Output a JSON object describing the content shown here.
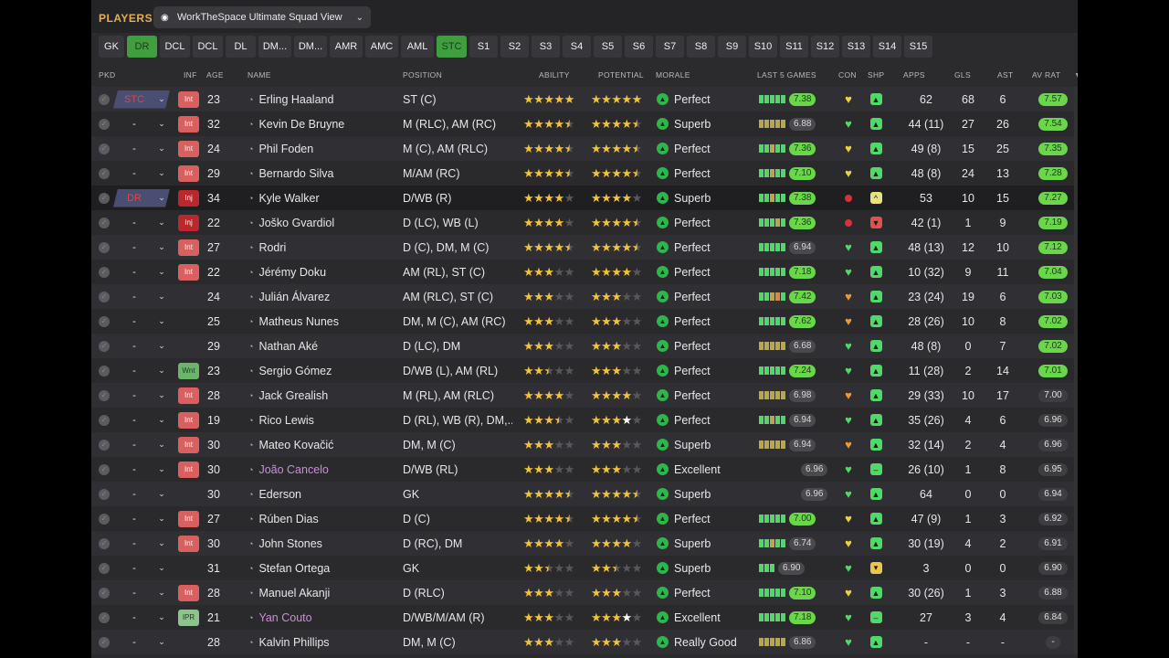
{
  "header": {
    "title": "PLAYERS",
    "view_name": "WorkTheSpace Ultimate Squad View"
  },
  "tabs": [
    {
      "label": "GK",
      "active": false,
      "w": 28
    },
    {
      "label": "DR",
      "active": true,
      "w": 33
    },
    {
      "label": "DCL",
      "active": false,
      "w": 33
    },
    {
      "label": "DCL",
      "active": false,
      "w": 33
    },
    {
      "label": "DL",
      "active": false,
      "w": 33
    },
    {
      "label": "DM...",
      "active": false,
      "w": 36
    },
    {
      "label": "DM...",
      "active": false,
      "w": 36
    },
    {
      "label": "AMR",
      "active": false,
      "w": 36
    },
    {
      "label": "AMC",
      "active": false,
      "w": 36
    },
    {
      "label": "AML",
      "active": false,
      "w": 36
    },
    {
      "label": "STC",
      "active": true,
      "w": 33
    },
    {
      "label": "S1",
      "active": false,
      "w": 31
    },
    {
      "label": "S2",
      "active": false,
      "w": 31
    },
    {
      "label": "S3",
      "active": false,
      "w": 31
    },
    {
      "label": "S4",
      "active": false,
      "w": 31
    },
    {
      "label": "S5",
      "active": false,
      "w": 31
    },
    {
      "label": "S6",
      "active": false,
      "w": 31
    },
    {
      "label": "S7",
      "active": false,
      "w": 31
    },
    {
      "label": "S8",
      "active": false,
      "w": 31
    },
    {
      "label": "S9",
      "active": false,
      "w": 31
    },
    {
      "label": "S10",
      "active": false,
      "w": 31
    },
    {
      "label": "S11",
      "active": false,
      "w": 31
    },
    {
      "label": "S12",
      "active": false,
      "w": 31
    },
    {
      "label": "S13",
      "active": false,
      "w": 31
    },
    {
      "label": "S14",
      "active": false,
      "w": 31
    },
    {
      "label": "S15",
      "active": false,
      "w": 31
    }
  ],
  "columns": {
    "pkd": "PKD",
    "inf": "INF",
    "age": "AGE",
    "name": "NAME",
    "position": "POSITION",
    "ability": "ABILITY",
    "potential": "POTENTIAL",
    "morale": "MORALE",
    "last5": "LAST 5 GAMES",
    "con": "CON",
    "shp": "SHP",
    "apps": "APPS",
    "gls": "GLS",
    "ast": "AST",
    "avrat": "AV RAT",
    "sort_icon": "▼"
  },
  "colors": {
    "accent": "#e3b04b",
    "tab_active": "#3f9f3f",
    "good_rating": "#6ad64a",
    "injury": "#b8282c",
    "intl": "#d9605e",
    "heart_green": "#4fd968",
    "heart_yellow": "#e8d34a",
    "heart_orange": "#e89a3a"
  },
  "players": [
    {
      "sel": "STC",
      "assigned": true,
      "inf": "Int",
      "age": "23",
      "name": "Erling Haaland",
      "loan": false,
      "position": "ST (C)",
      "ability": 5,
      "potential": 5,
      "pot_white": 0,
      "morale": "Perfect",
      "last5": [
        "g",
        "g",
        "g",
        "g",
        "g"
      ],
      "rating": "7.38",
      "rating_good": true,
      "con": "yellow",
      "shp": "green",
      "apps": "62",
      "gls": "68",
      "ast": "6",
      "avrat": "7.57",
      "av_good": true,
      "hl": false
    },
    {
      "sel": "-",
      "assigned": false,
      "inf": "Int",
      "age": "32",
      "name": "Kevin De Bruyne",
      "loan": false,
      "position": "M (RLC), AM (RC)",
      "ability": 4.5,
      "potential": 4.5,
      "pot_white": 0,
      "morale": "Superb",
      "last5": [
        "y",
        "y",
        "y",
        "y",
        "y"
      ],
      "rating": "6.88",
      "rating_good": false,
      "con": "green",
      "shp": "green",
      "apps": "44 (11)",
      "gls": "27",
      "ast": "26",
      "avrat": "7.54",
      "av_good": true,
      "hl": false
    },
    {
      "sel": "-",
      "assigned": false,
      "inf": "Int",
      "age": "24",
      "name": "Phil Foden",
      "loan": false,
      "position": "M (C), AM (RLC)",
      "ability": 4.5,
      "potential": 4.5,
      "pot_white": 0,
      "morale": "Perfect",
      "last5": [
        "g",
        "g",
        "y",
        "g",
        "g"
      ],
      "rating": "7.36",
      "rating_good": true,
      "con": "yellow",
      "shp": "green",
      "apps": "49 (8)",
      "gls": "15",
      "ast": "25",
      "avrat": "7.35",
      "av_good": true,
      "hl": false
    },
    {
      "sel": "-",
      "assigned": false,
      "inf": "Int",
      "age": "29",
      "name": "Bernardo Silva",
      "loan": false,
      "position": "M/AM (RC)",
      "ability": 4.5,
      "potential": 4.5,
      "pot_white": 0,
      "morale": "Perfect",
      "last5": [
        "g",
        "g",
        "y",
        "g",
        "g"
      ],
      "rating": "7.10",
      "rating_good": true,
      "con": "yellow",
      "shp": "green",
      "apps": "48 (8)",
      "gls": "24",
      "ast": "13",
      "avrat": "7.28",
      "av_good": true,
      "hl": false
    },
    {
      "sel": "DR",
      "assigned": true,
      "inf": "Inj",
      "age": "34",
      "name": "Kyle Walker",
      "loan": false,
      "position": "D/WB (R)",
      "ability": 4,
      "potential": 4,
      "pot_white": 0,
      "morale": "Superb",
      "last5": [
        "g",
        "g",
        "y",
        "g",
        "g"
      ],
      "rating": "7.38",
      "rating_good": true,
      "con": "dot",
      "shp": "up",
      "apps": "53",
      "gls": "10",
      "ast": "15",
      "avrat": "7.27",
      "av_good": true,
      "hl": true
    },
    {
      "sel": "-",
      "assigned": false,
      "inf": "Inj",
      "age": "22",
      "name": "Joško Gvardiol",
      "loan": false,
      "position": "D (LC), WB (L)",
      "ability": 4,
      "potential": 4.5,
      "pot_white": 0,
      "morale": "Perfect",
      "last5": [
        "g",
        "g",
        "g",
        "y",
        "g"
      ],
      "rating": "7.36",
      "rating_good": true,
      "con": "dot",
      "shp": "red",
      "apps": "42 (1)",
      "gls": "1",
      "ast": "9",
      "avrat": "7.19",
      "av_good": true,
      "hl": false
    },
    {
      "sel": "-",
      "assigned": false,
      "inf": "Int",
      "age": "27",
      "name": "Rodri",
      "loan": false,
      "position": "D (C), DM, M (C)",
      "ability": 4.5,
      "potential": 4.5,
      "pot_white": 0,
      "morale": "Perfect",
      "last5": [
        "g",
        "g",
        "g",
        "g",
        "g"
      ],
      "rating": "6.94",
      "rating_good": false,
      "con": "green",
      "shp": "green",
      "apps": "48 (13)",
      "gls": "12",
      "ast": "10",
      "avrat": "7.12",
      "av_good": true,
      "hl": false
    },
    {
      "sel": "-",
      "assigned": false,
      "inf": "Int",
      "age": "22",
      "name": "Jérémy Doku",
      "loan": false,
      "position": "AM (RL), ST (C)",
      "ability": 3,
      "potential": 4,
      "pot_white": 0,
      "morale": "Perfect",
      "last5": [
        "g",
        "g",
        "g",
        "g",
        "g"
      ],
      "rating": "7.18",
      "rating_good": true,
      "con": "green",
      "shp": "green",
      "apps": "10 (32)",
      "gls": "9",
      "ast": "11",
      "avrat": "7.04",
      "av_good": true,
      "hl": false
    },
    {
      "sel": "-",
      "assigned": false,
      "inf": "",
      "age": "24",
      "name": "Julián Álvarez",
      "loan": false,
      "position": "AM (RLC), ST (C)",
      "ability": 3,
      "potential": 3,
      "pot_white": 0,
      "morale": "Perfect",
      "last5": [
        "g",
        "g",
        "y",
        "o",
        "g"
      ],
      "rating": "7.42",
      "rating_good": true,
      "con": "orange",
      "shp": "green",
      "apps": "23 (24)",
      "gls": "19",
      "ast": "6",
      "avrat": "7.03",
      "av_good": true,
      "hl": false
    },
    {
      "sel": "-",
      "assigned": false,
      "inf": "",
      "age": "25",
      "name": "Matheus Nunes",
      "loan": false,
      "position": "DM, M (C), AM (RC)",
      "ability": 3,
      "potential": 3,
      "pot_white": 0,
      "morale": "Perfect",
      "last5": [
        "g",
        "g",
        "g",
        "g",
        "g"
      ],
      "rating": "7.62",
      "rating_good": true,
      "con": "orange",
      "shp": "green",
      "apps": "28 (26)",
      "gls": "10",
      "ast": "8",
      "avrat": "7.02",
      "av_good": true,
      "hl": false
    },
    {
      "sel": "-",
      "assigned": false,
      "inf": "",
      "age": "29",
      "name": "Nathan Aké",
      "loan": false,
      "position": "D (LC), DM",
      "ability": 3,
      "potential": 3,
      "pot_white": 0,
      "morale": "Perfect",
      "last5": [
        "y",
        "y",
        "y",
        "y",
        "y"
      ],
      "rating": "6.68",
      "rating_good": false,
      "con": "green",
      "shp": "green",
      "apps": "48 (8)",
      "gls": "0",
      "ast": "7",
      "avrat": "7.02",
      "av_good": true,
      "hl": false
    },
    {
      "sel": "-",
      "assigned": false,
      "inf": "Wnt",
      "age": "23",
      "name": "Sergio Gómez",
      "loan": false,
      "position": "D/WB (L), AM (RL)",
      "ability": 2.5,
      "potential": 3,
      "pot_white": 0,
      "morale": "Perfect",
      "last5": [
        "g",
        "g",
        "g",
        "g",
        "g"
      ],
      "rating": "7.24",
      "rating_good": true,
      "con": "green",
      "shp": "green",
      "apps": "11 (28)",
      "gls": "2",
      "ast": "14",
      "avrat": "7.01",
      "av_good": true,
      "hl": false
    },
    {
      "sel": "-",
      "assigned": false,
      "inf": "Int",
      "age": "28",
      "name": "Jack Grealish",
      "loan": false,
      "position": "M (RL), AM (RLC)",
      "ability": 4,
      "potential": 4,
      "pot_white": 0,
      "morale": "Perfect",
      "last5": [
        "y",
        "y",
        "y",
        "y",
        "y"
      ],
      "rating": "6.98",
      "rating_good": false,
      "con": "orange",
      "shp": "green",
      "apps": "29 (33)",
      "gls": "10",
      "ast": "17",
      "avrat": "7.00",
      "av_good": false,
      "hl": false
    },
    {
      "sel": "-",
      "assigned": false,
      "inf": "Int",
      "age": "19",
      "name": "Rico Lewis",
      "loan": false,
      "position": "D (RL), WB (R), DM,...",
      "ability": 3.5,
      "potential": 3,
      "pot_white": 1.5,
      "morale": "Perfect",
      "last5": [
        "g",
        "g",
        "y",
        "g",
        "g"
      ],
      "rating": "6.94",
      "rating_good": false,
      "con": "green",
      "shp": "green",
      "apps": "35 (26)",
      "gls": "4",
      "ast": "6",
      "avrat": "6.96",
      "av_good": false,
      "hl": false
    },
    {
      "sel": "-",
      "assigned": false,
      "inf": "Int",
      "age": "30",
      "name": "Mateo Kovačić",
      "loan": false,
      "position": "DM, M (C)",
      "ability": 3,
      "potential": 3,
      "pot_white": 0,
      "morale": "Superb",
      "last5": [
        "y",
        "y",
        "y",
        "y",
        "y"
      ],
      "rating": "6.94",
      "rating_good": false,
      "con": "orange",
      "shp": "green",
      "apps": "32 (14)",
      "gls": "2",
      "ast": "4",
      "avrat": "6.96",
      "av_good": false,
      "hl": false
    },
    {
      "sel": "-",
      "assigned": false,
      "inf": "Int",
      "age": "30",
      "name": "João Cancelo",
      "loan": true,
      "position": "D/WB (RL)",
      "ability": 3,
      "potential": 3,
      "pot_white": 0,
      "morale": "Excellent",
      "last5": [],
      "rating": "6.96",
      "rating_good": false,
      "con": "green",
      "shp": "flat",
      "apps": "26 (10)",
      "gls": "1",
      "ast": "8",
      "avrat": "6.95",
      "av_good": false,
      "hl": false
    },
    {
      "sel": "-",
      "assigned": false,
      "inf": "",
      "age": "30",
      "name": "Ederson",
      "loan": false,
      "position": "GK",
      "ability": 4.5,
      "potential": 4.5,
      "pot_white": 0,
      "morale": "Superb",
      "last5": [],
      "rating": "6.96",
      "rating_good": false,
      "con": "green",
      "shp": "green",
      "apps": "64",
      "gls": "0",
      "ast": "0",
      "avrat": "6.94",
      "av_good": false,
      "hl": false
    },
    {
      "sel": "-",
      "assigned": false,
      "inf": "Int",
      "age": "27",
      "name": "Rúben Dias",
      "loan": false,
      "position": "D (C)",
      "ability": 4.5,
      "potential": 4.5,
      "pot_white": 0,
      "morale": "Perfect",
      "last5": [
        "g",
        "g",
        "g",
        "g",
        "g"
      ],
      "rating": "7.00",
      "rating_good": true,
      "con": "yellow",
      "shp": "green",
      "apps": "47 (9)",
      "gls": "1",
      "ast": "3",
      "avrat": "6.92",
      "av_good": false,
      "hl": false
    },
    {
      "sel": "-",
      "assigned": false,
      "inf": "Int",
      "age": "30",
      "name": "John Stones",
      "loan": false,
      "position": "D (RC), DM",
      "ability": 4,
      "potential": 4,
      "pot_white": 0,
      "morale": "Superb",
      "last5": [
        "g",
        "g",
        "y",
        "g",
        "g"
      ],
      "rating": "6.74",
      "rating_good": false,
      "con": "yellow",
      "shp": "green",
      "apps": "30 (19)",
      "gls": "4",
      "ast": "2",
      "avrat": "6.91",
      "av_good": false,
      "hl": false
    },
    {
      "sel": "-",
      "assigned": false,
      "inf": "",
      "age": "31",
      "name": "Stefan Ortega",
      "loan": false,
      "position": "GK",
      "ability": 2.5,
      "potential": 2.5,
      "pot_white": 0,
      "morale": "Superb",
      "last5": [
        "g",
        "g",
        "g"
      ],
      "rating": "6.90",
      "rating_good": false,
      "con": "green",
      "shp": "yellow",
      "apps": "3",
      "gls": "0",
      "ast": "0",
      "avrat": "6.90",
      "av_good": false,
      "hl": false
    },
    {
      "sel": "-",
      "assigned": false,
      "inf": "Int",
      "age": "28",
      "name": "Manuel Akanji",
      "loan": false,
      "position": "D (RLC)",
      "ability": 3,
      "potential": 3,
      "pot_white": 0,
      "morale": "Perfect",
      "last5": [
        "g",
        "g",
        "g",
        "g",
        "g"
      ],
      "rating": "7.10",
      "rating_good": true,
      "con": "yellow",
      "shp": "green",
      "apps": "30 (26)",
      "gls": "1",
      "ast": "3",
      "avrat": "6.88",
      "av_good": false,
      "hl": false
    },
    {
      "sel": "-",
      "assigned": false,
      "inf": "IPR",
      "age": "21",
      "name": "Yan Couto",
      "loan": true,
      "position": "D/WB/M/AM (R)",
      "ability": 3,
      "potential": 3,
      "pot_white": 1,
      "morale": "Excellent",
      "last5": [
        "g",
        "g",
        "g",
        "g",
        "g"
      ],
      "rating": "7.18",
      "rating_good": true,
      "con": "green",
      "shp": "flat",
      "apps": "27",
      "gls": "3",
      "ast": "4",
      "avrat": "6.84",
      "av_good": false,
      "hl": false
    },
    {
      "sel": "-",
      "assigned": false,
      "inf": "",
      "age": "28",
      "name": "Kalvin Phillips",
      "loan": false,
      "position": "DM, M (C)",
      "ability": 3,
      "potential": 3,
      "pot_white": 0,
      "morale": "Really Good",
      "last5": [
        "y",
        "y",
        "y",
        "y",
        "y"
      ],
      "rating": "6.86",
      "rating_good": false,
      "con": "green",
      "shp": "green",
      "apps": "-",
      "gls": "-",
      "ast": "-",
      "avrat": "-",
      "av_good": false,
      "hl": false
    }
  ]
}
